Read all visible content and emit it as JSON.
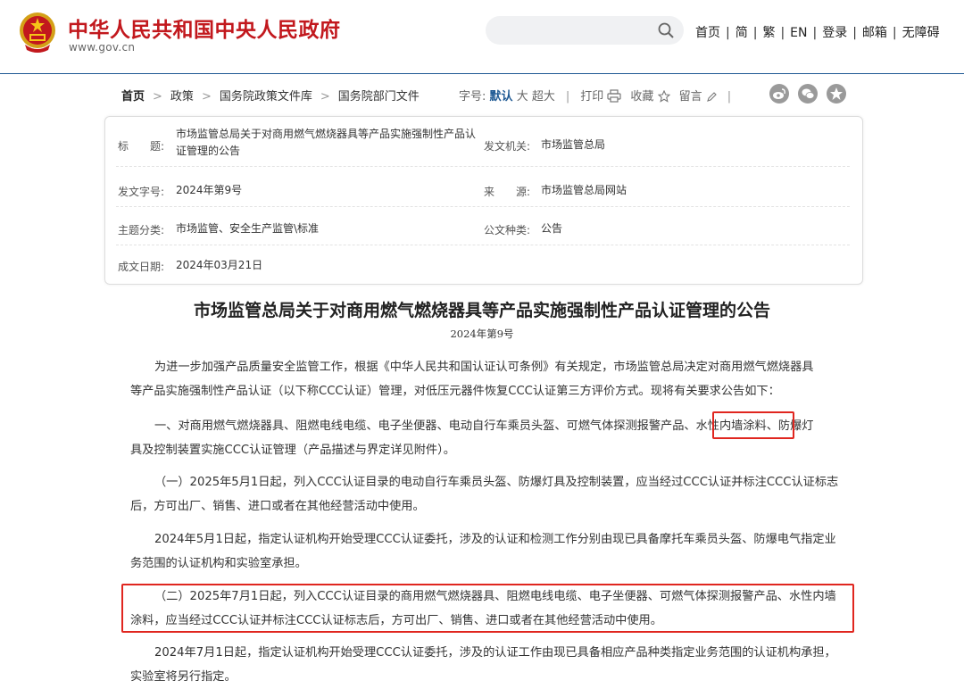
{
  "header": {
    "site_title": "中华人民共和国中央人民政府",
    "site_domain": "www.gov.cn",
    "search_placeholder": "",
    "nav": [
      "首页",
      "简",
      "繁",
      "EN",
      "登录",
      "邮箱",
      "无障碍"
    ],
    "emblem_color": "#c2181d"
  },
  "breadcrumb": [
    "首页",
    "政策",
    "国务院政策文件库",
    "国务院部门文件"
  ],
  "tools": {
    "font_label": "字号:",
    "font_default": "默认",
    "font_large": "大",
    "font_xlarge": "超大",
    "print": "打印",
    "favorite": "收藏",
    "comment": "留言",
    "share_icons": [
      "weibo-icon",
      "wechat-icon",
      "qzone-icon"
    ]
  },
  "meta": {
    "title_label": "标　　题:",
    "title_line1": "市场监管总局关于对商用燃气燃烧器具等产品实施强制性产品认",
    "title_line2": "证管理的公告",
    "issuer_label": "发文机关:",
    "issuer": "市场监管总局",
    "doc_no_label": "发文字号:",
    "doc_no": "2024年第9号",
    "source_label": "来　　源:",
    "source": "市场监管总局网站",
    "topic_label": "主题分类:",
    "topic": "市场监管、安全生产监管\\标准",
    "type_label": "公文种类:",
    "type": "公告",
    "date_label": "成文日期:",
    "date": "2024年03月21日"
  },
  "article": {
    "title": "市场监管总局关于对商用燃气燃烧器具等产品实施强制性产品认证管理的公告",
    "number": "2024年第9号",
    "p1_l1": "为进一步加强产品质量安全监管工作，根据《中华人民共和国认证认可条例》有关规定，市场监管总局决定对商用燃气燃烧器具",
    "p1_l2": "等产品实施强制性产品认证（以下称CCC认证）管理，对低压元器件恢复CCC认证第三方评价方式。现将有关要求公告如下：",
    "p2_l1a": "一、对商用燃气燃烧器具、阻燃电线电缆、电子坐便器、电动自行车乘员头盔、可燃气体探测报警产品、",
    "p2_l1b": "水性内墙涂料",
    "p2_l1c": "、防爆灯",
    "p2_l2": "具及控制装置实施CCC认证管理（产品描述与界定详见附件）。",
    "p3_l1": "（一）2025年5月1日起，列入CCC认证目录的电动自行车乘员头盔、防爆灯具及控制装置，应当经过CCC认证并标注CCC认证标志",
    "p3_l2": "后，方可出厂、销售、进口或者在其他经营活动中使用。",
    "p4_l1": "2024年5月1日起，指定认证机构开始受理CCC认证委托，涉及的认证和检测工作分别由现已具备摩托车乘员头盔、防爆电气指定业",
    "p4_l2": "务范围的认证机构和实验室承担。",
    "p5_l1": "（二）2025年7月1日起，列入CCC认证目录的商用燃气燃烧器具、阻燃电线电缆、电子坐便器、可燃气体探测报警产品、水性内墙",
    "p5_l2": "涂料，应当经过CCC认证并标注CCC认证标志后，方可出厂、销售、进口或者在其他经营活动中使用。",
    "p6_l1": "2024年7月1日起，指定认证机构开始受理CCC认证委托，涉及的认证工作由现已具备相应产品种类指定业务范围的认证机构承担，",
    "p6_l2": "实验室将另行指定。"
  },
  "highlight_color": "#e0261f"
}
